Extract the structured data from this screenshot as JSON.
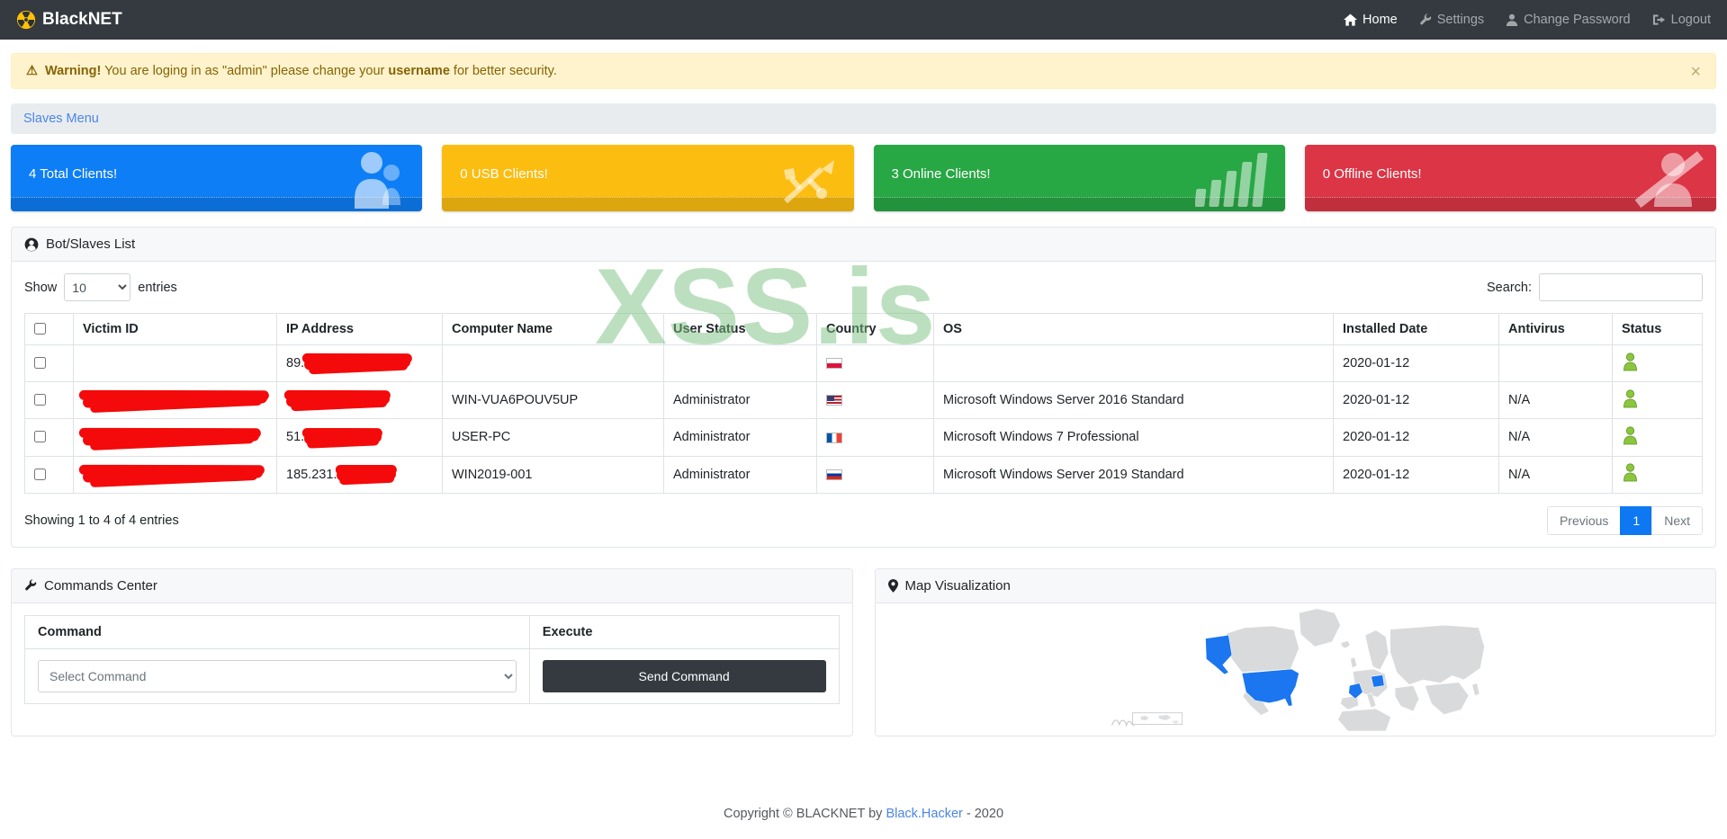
{
  "colors": {
    "navbar_bg": "#343a40",
    "brand_icon": "#ffc107",
    "primary": "#0d78f2",
    "link": "#4a86e8",
    "alert_bg": "#fff3cd",
    "alert_border": "#ffeeba",
    "alert_text": "#856404",
    "status_green": "#8cc63f",
    "redact": "#f40a0a",
    "watermark_green": "#7cc281",
    "map_land": "#d8dadc",
    "map_highlight": "#1b76f0",
    "button_dark": "#343a40"
  },
  "navbar": {
    "brand": "BlackNET",
    "items": [
      {
        "label": "Home",
        "icon": "home-icon",
        "active": true
      },
      {
        "label": "Settings",
        "icon": "wrench-icon",
        "active": false
      },
      {
        "label": "Change Password",
        "icon": "user-icon",
        "active": false
      },
      {
        "label": "Logout",
        "icon": "logout-icon",
        "active": false
      }
    ]
  },
  "alert": {
    "bold": "Warning!",
    "text_before": " You are loging in as \"admin\" please change your ",
    "highlight": "username",
    "text_after": " for better security.",
    "close": "×"
  },
  "menu_bar": {
    "label": "Slaves Menu"
  },
  "stat_cards": [
    {
      "label": "4 Total Clients!",
      "color": "#0d7ef5",
      "icon": "users-icon"
    },
    {
      "label": "0 USB Clients!",
      "color": "#fcbd11",
      "icon": "usb-icon"
    },
    {
      "label": "3 Online Clients!",
      "color": "#28a745",
      "icon": "signal-bars-icon"
    },
    {
      "label": "0 Offline Clients!",
      "color": "#dc3545",
      "icon": "user-slash-icon"
    }
  ],
  "bot_list": {
    "title": "Bot/Slaves List",
    "icon": "user-circle-icon",
    "show_label": "Show",
    "page_size": "10",
    "entries_label": "entries",
    "search_label": "Search:",
    "watermark": "XSS.is",
    "columns": [
      "",
      "Victim ID",
      "IP Address",
      "Computer Name",
      "User Status",
      "Country",
      "OS",
      "Installed Date",
      "Antivirus",
      "Status"
    ],
    "rows": [
      {
        "victim_w": 0,
        "ip_prefix": "89.",
        "ip_w": 118,
        "computer": "",
        "user_status": "",
        "country": "pl",
        "os": "",
        "installed": "2020-01-12",
        "antivirus": "",
        "status": "online"
      },
      {
        "victim_w": 205,
        "ip_prefix": "",
        "ip_w": 115,
        "computer": "WIN-VUA6POUV5UP",
        "user_status": "Administrator",
        "country": "us",
        "os": "Microsoft Windows Server 2016 Standard",
        "installed": "2020-01-12",
        "antivirus": "N/A",
        "status": "online"
      },
      {
        "victim_w": 196,
        "ip_prefix": "51.",
        "ip_w": 86,
        "computer": "USER-PC",
        "user_status": "Administrator",
        "country": "fr",
        "os": "Microsoft Windows 7 Professional",
        "installed": "2020-01-12",
        "antivirus": "N/A",
        "status": "online"
      },
      {
        "victim_w": 200,
        "ip_prefix": "185.231.",
        "ip_w": 66,
        "computer": "WIN2019-001",
        "user_status": "Administrator",
        "country": "ru",
        "os": "Microsoft Windows Server 2019 Standard",
        "installed": "2020-01-12",
        "antivirus": "N/A",
        "status": "online"
      }
    ],
    "info": "Showing 1 to 4 of 4 entries",
    "pagination": {
      "previous": "Previous",
      "page": "1",
      "next": "Next"
    }
  },
  "commands_center": {
    "title": "Commands Center",
    "icon": "wrench-icon",
    "command_col": "Command",
    "execute_col": "Execute",
    "select_placeholder": "Select Command",
    "button": "Send Command"
  },
  "map": {
    "title": "Map Visualization",
    "icon": "map-marker-icon",
    "highlighted_countries": [
      "United States",
      "Alaska (US)",
      "France",
      "Poland"
    ]
  },
  "footer": {
    "text_before": "Copyright © BLACKNET by ",
    "link": "Black.Hacker",
    "text_after": " - 2020"
  }
}
